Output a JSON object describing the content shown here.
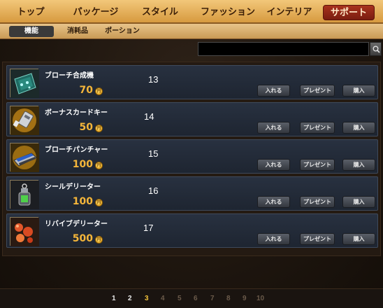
{
  "main_tabs": [
    {
      "label": "トップ"
    },
    {
      "label": "パッケージ"
    },
    {
      "label": "スタイル"
    },
    {
      "label": "ファッション"
    },
    {
      "label": "インテリア"
    },
    {
      "label": "サポート",
      "active": true
    }
  ],
  "sub_tabs": [
    {
      "label": "機能",
      "active": true
    },
    {
      "label": "消耗品"
    },
    {
      "label": "ポーション"
    }
  ],
  "search": {
    "value": "",
    "placeholder": ""
  },
  "buttons": {
    "put_in": "入れる",
    "present": "プレゼント",
    "buy": "購入"
  },
  "coin_symbol": "円",
  "items": [
    {
      "name": "ブローチ合成機",
      "price": "70",
      "number": "13",
      "icon": "brooch-synth-icon"
    },
    {
      "name": "ボーナスカードキー",
      "price": "50",
      "number": "14",
      "icon": "card-key-icon"
    },
    {
      "name": "ブローチパンチャー",
      "price": "100",
      "number": "15",
      "icon": "brooch-puncher-icon"
    },
    {
      "name": "シールデリーター",
      "price": "100",
      "number": "16",
      "icon": "seal-deleter-icon"
    },
    {
      "name": "リバイブデリーター",
      "price": "500",
      "number": "17",
      "icon": "revive-deleter-icon"
    }
  ],
  "pager": {
    "pages": [
      "1",
      "2",
      "3",
      "4",
      "5",
      "6",
      "7",
      "8",
      "9",
      "10"
    ],
    "current": "3"
  },
  "colors": {
    "accent": "#f5b63a",
    "active_tab": "#8a2614",
    "tab_bar": "#e3ad5e"
  }
}
